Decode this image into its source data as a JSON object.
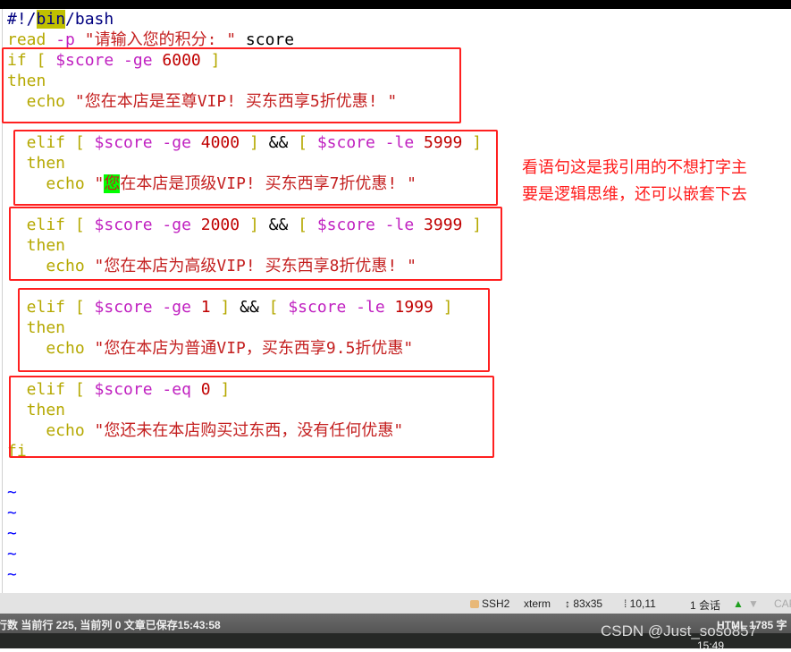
{
  "editor": {
    "lines": [
      [
        [
          "#!/",
          "shebang"
        ],
        [
          "bin",
          "hl-olive"
        ],
        [
          "/bash",
          "shebang"
        ]
      ],
      [
        [
          "read",
          "kw"
        ],
        [
          " ",
          "plain"
        ],
        [
          "-p",
          "var"
        ],
        [
          " \"请输入您的积分: \"",
          "str"
        ],
        [
          " score",
          "plain"
        ]
      ],
      [
        [
          "if [ ",
          "kw"
        ],
        [
          "$score -ge",
          "var"
        ],
        [
          " 6000",
          "num"
        ],
        [
          " ]",
          "kw"
        ]
      ],
      [
        [
          "then",
          "kw"
        ]
      ],
      [
        [
          "  echo ",
          "kw"
        ],
        [
          "\"您在本店是至尊VIP! 买东西享5折优惠! \"",
          "str"
        ]
      ],
      [],
      [
        [
          "  elif [ ",
          "kw"
        ],
        [
          "$score -ge",
          "var"
        ],
        [
          " 4000",
          "num"
        ],
        [
          " ] ",
          "kw"
        ],
        [
          "&&",
          "plain"
        ],
        [
          " [ ",
          "kw"
        ],
        [
          "$score -le",
          "var"
        ],
        [
          " 5999",
          "num"
        ],
        [
          " ]",
          "kw"
        ]
      ],
      [
        [
          "  then",
          "kw"
        ]
      ],
      [
        [
          "    echo ",
          "kw"
        ],
        [
          "\"",
          "str"
        ],
        [
          "您",
          "hl-green"
        ],
        [
          "在本店是顶级VIP! 买东西享7折优惠! \"",
          "str"
        ]
      ],
      [],
      [
        [
          "  elif [ ",
          "kw"
        ],
        [
          "$score -ge",
          "var"
        ],
        [
          " 2000",
          "num"
        ],
        [
          " ] ",
          "kw"
        ],
        [
          "&&",
          "plain"
        ],
        [
          " [ ",
          "kw"
        ],
        [
          "$score -le",
          "var"
        ],
        [
          " 3999",
          "num"
        ],
        [
          " ]",
          "kw"
        ]
      ],
      [
        [
          "  then",
          "kw"
        ]
      ],
      [
        [
          "    echo ",
          "kw"
        ],
        [
          "\"您在本店为高级VIP! 买东西享8折优惠! \"",
          "str"
        ]
      ],
      [],
      [
        [
          "  elif [ ",
          "kw"
        ],
        [
          "$score -ge",
          "var"
        ],
        [
          " 1",
          "num"
        ],
        [
          " ] ",
          "kw"
        ],
        [
          "&&",
          "plain"
        ],
        [
          " [ ",
          "kw"
        ],
        [
          "$score -le",
          "var"
        ],
        [
          " 1999",
          "num"
        ],
        [
          " ]",
          "kw"
        ]
      ],
      [
        [
          "  then",
          "kw"
        ]
      ],
      [
        [
          "    echo ",
          "kw"
        ],
        [
          "\"您在本店为普通VIP，买东西享9.5折优惠\"",
          "str"
        ]
      ],
      [],
      [
        [
          "  elif [ ",
          "kw"
        ],
        [
          "$score -eq",
          "var"
        ],
        [
          " 0",
          "num"
        ],
        [
          " ]",
          "kw"
        ]
      ],
      [
        [
          "  then",
          "kw"
        ]
      ],
      [
        [
          "    echo ",
          "kw"
        ],
        [
          "\"您还未在本店购买过东西，没有任何优惠\"",
          "str"
        ]
      ],
      [
        [
          "fi",
          "kw"
        ]
      ],
      [],
      [
        [
          "~",
          "tilde"
        ]
      ],
      [
        [
          "~",
          "tilde"
        ]
      ],
      [
        [
          "~",
          "tilde"
        ]
      ],
      [
        [
          "~",
          "tilde"
        ]
      ],
      [
        [
          "~",
          "tilde"
        ]
      ]
    ]
  },
  "annotation": {
    "line1": "看语句这是我引用的不想打字主",
    "line2": "要是逻辑思维，还可以嵌套下去",
    "color": "#ff1a1a"
  },
  "statusbar": {
    "protocol": "SSH2",
    "terminal": "xterm",
    "size": "83x35",
    "cursor": "10,11",
    "sessions": "1 会话",
    "caps": "CAP"
  },
  "editor_status": {
    "left": "行数  当前行 225, 当前列 0   文章已保存15:43:58",
    "right": "HTML  1785 字"
  },
  "watermark": "CSDN @Just_soso857",
  "clock": "15:49",
  "colors": {
    "keyword": "#b5a800",
    "variable": "#c020c0",
    "number": "#c00000",
    "string": "#c42020",
    "box": "#ff2020"
  }
}
